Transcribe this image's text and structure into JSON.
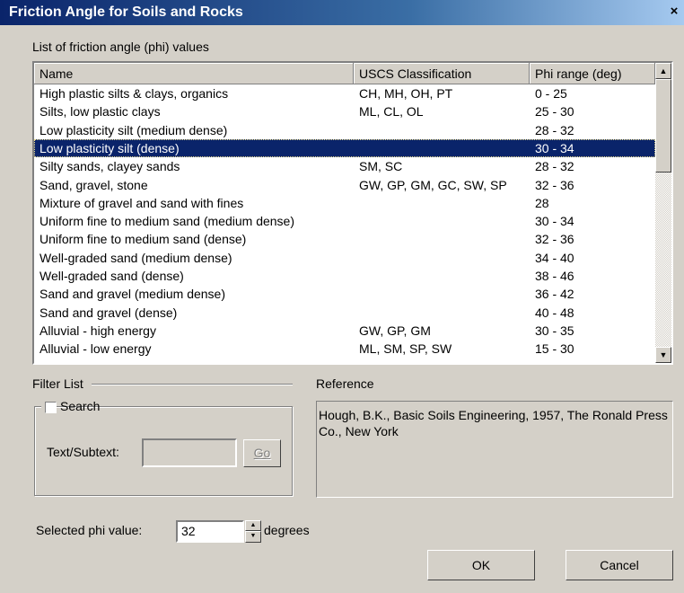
{
  "window": {
    "title": "Friction Angle for Soils and Rocks",
    "close_glyph": "×"
  },
  "list": {
    "label": "List of friction angle (phi) values",
    "columns": [
      "Name",
      "USCS Classification",
      "Phi range (deg)"
    ],
    "selected_index": 3,
    "rows": [
      [
        "High plastic silts & clays, organics",
        "CH, MH, OH, PT",
        "0 - 25"
      ],
      [
        "Silts, low plastic clays",
        "ML, CL, OL",
        "25 - 30"
      ],
      [
        "Low plasticity silt (medium dense)",
        "",
        "28 - 32"
      ],
      [
        "Low plasticity silt (dense)",
        "",
        "30 - 34"
      ],
      [
        "Silty sands, clayey sands",
        "SM, SC",
        "28 - 32"
      ],
      [
        "Sand, gravel, stone",
        "GW, GP, GM, GC, SW, SP",
        "32 - 36"
      ],
      [
        "Mixture of gravel and sand with fines",
        "",
        "28"
      ],
      [
        "Uniform fine to medium sand (medium dense)",
        "",
        "30 - 34"
      ],
      [
        "Uniform fine to medium sand (dense)",
        "",
        "32 - 36"
      ],
      [
        "Well-graded sand (medium dense)",
        "",
        "34 - 40"
      ],
      [
        "Well-graded sand (dense)",
        "",
        "38 - 46"
      ],
      [
        "Sand and gravel (medium dense)",
        "",
        "36 - 42"
      ],
      [
        "Sand and gravel (dense)",
        "",
        "40 - 48"
      ],
      [
        "Alluvial - high energy",
        "GW, GP, GM",
        "30 - 35"
      ],
      [
        "Alluvial - low energy",
        "ML, SM, SP, SW",
        "15 - 30"
      ]
    ]
  },
  "filter": {
    "label": "Filter List",
    "search_label": "Search",
    "search_checked": false,
    "text_label": "Text/Subtext:",
    "text_value": "",
    "go_label": "Go"
  },
  "reference": {
    "label": "Reference",
    "text": "Hough, B.K., Basic Soils Engineering, 1957, The Ronald Press Co., New York"
  },
  "phi": {
    "label": "Selected phi value:",
    "value": "32",
    "unit": "degrees"
  },
  "buttons": {
    "ok": "OK",
    "cancel": "Cancel"
  }
}
